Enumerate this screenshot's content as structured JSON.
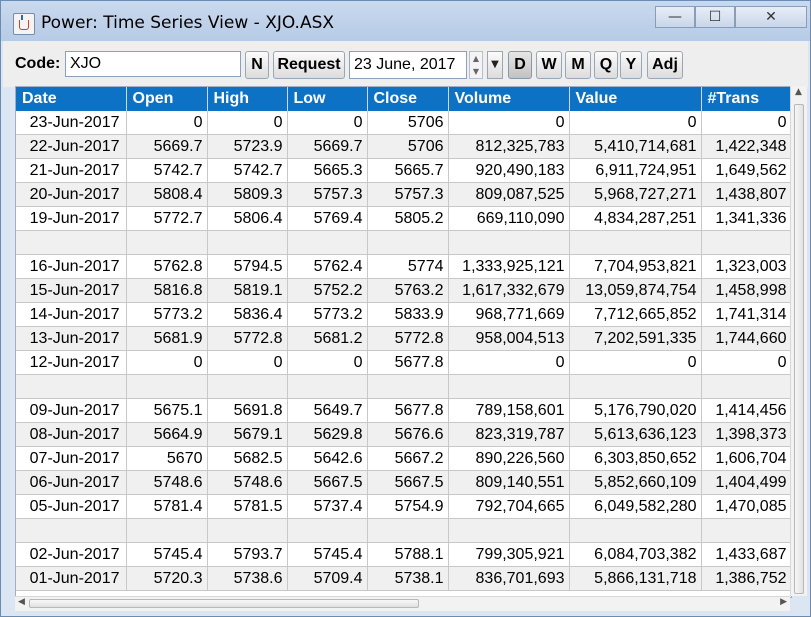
{
  "window": {
    "title": "Power: Time Series View - XJO.ASX",
    "controls": {
      "minimize": "—",
      "maximize": "☐",
      "close": "✕"
    }
  },
  "toolbar": {
    "code_label": "Code:",
    "code_value": "XJO",
    "n_label": "N",
    "request_label": "Request",
    "date_value": "23 June, 2017",
    "period_buttons": [
      "D",
      "W",
      "M",
      "Q",
      "Y"
    ],
    "selected_period": "D",
    "adj_label": "Adj"
  },
  "table": {
    "columns": [
      "Date",
      "Open",
      "High",
      "Low",
      "Close",
      "Volume",
      "Value",
      "#Trans"
    ],
    "rows": [
      [
        "23-Jun-2017",
        "0",
        "0",
        "0",
        "5706",
        "0",
        "0",
        "0"
      ],
      [
        "22-Jun-2017",
        "5669.7",
        "5723.9",
        "5669.7",
        "5706",
        "812,325,783",
        "5,410,714,681",
        "1,422,348"
      ],
      [
        "21-Jun-2017",
        "5742.7",
        "5742.7",
        "5665.3",
        "5665.7",
        "920,490,183",
        "6,911,724,951",
        "1,649,562"
      ],
      [
        "20-Jun-2017",
        "5808.4",
        "5809.3",
        "5757.3",
        "5757.3",
        "809,087,525",
        "5,968,727,271",
        "1,438,807"
      ],
      [
        "19-Jun-2017",
        "5772.7",
        "5806.4",
        "5769.4",
        "5805.2",
        "669,110,090",
        "4,834,287,251",
        "1,341,336"
      ],
      [
        "",
        "",
        "",
        "",
        "",
        "",
        "",
        ""
      ],
      [
        "16-Jun-2017",
        "5762.8",
        "5794.5",
        "5762.4",
        "5774",
        "1,333,925,121",
        "7,704,953,821",
        "1,323,003"
      ],
      [
        "15-Jun-2017",
        "5816.8",
        "5819.1",
        "5752.2",
        "5763.2",
        "1,617,332,679",
        "13,059,874,754",
        "1,458,998"
      ],
      [
        "14-Jun-2017",
        "5773.2",
        "5836.4",
        "5773.2",
        "5833.9",
        "968,771,669",
        "7,712,665,852",
        "1,741,314"
      ],
      [
        "13-Jun-2017",
        "5681.9",
        "5772.8",
        "5681.2",
        "5772.8",
        "958,004,513",
        "7,202,591,335",
        "1,744,660"
      ],
      [
        "12-Jun-2017",
        "0",
        "0",
        "0",
        "5677.8",
        "0",
        "0",
        "0"
      ],
      [
        "",
        "",
        "",
        "",
        "",
        "",
        "",
        ""
      ],
      [
        "09-Jun-2017",
        "5675.1",
        "5691.8",
        "5649.7",
        "5677.8",
        "789,158,601",
        "5,176,790,020",
        "1,414,456"
      ],
      [
        "08-Jun-2017",
        "5664.9",
        "5679.1",
        "5629.8",
        "5676.6",
        "823,319,787",
        "5,613,636,123",
        "1,398,373"
      ],
      [
        "07-Jun-2017",
        "5670",
        "5682.5",
        "5642.6",
        "5667.2",
        "890,226,560",
        "6,303,850,652",
        "1,606,704"
      ],
      [
        "06-Jun-2017",
        "5748.6",
        "5748.6",
        "5667.5",
        "5667.5",
        "809,140,551",
        "5,852,660,109",
        "1,404,499"
      ],
      [
        "05-Jun-2017",
        "5781.4",
        "5781.5",
        "5737.4",
        "5754.9",
        "792,704,665",
        "6,049,582,280",
        "1,470,085"
      ],
      [
        "",
        "",
        "",
        "",
        "",
        "",
        "",
        ""
      ],
      [
        "02-Jun-2017",
        "5745.4",
        "5793.7",
        "5745.4",
        "5788.1",
        "799,305,921",
        "6,084,703,382",
        "1,433,687"
      ],
      [
        "01-Jun-2017",
        "5720.3",
        "5738.6",
        "5709.4",
        "5738.1",
        "836,701,693",
        "5,866,131,718",
        "1,386,752"
      ]
    ]
  },
  "colors": {
    "header_bg": "#0e72c4",
    "header_text": "#ffffff",
    "grid": "#c8c8c8"
  }
}
